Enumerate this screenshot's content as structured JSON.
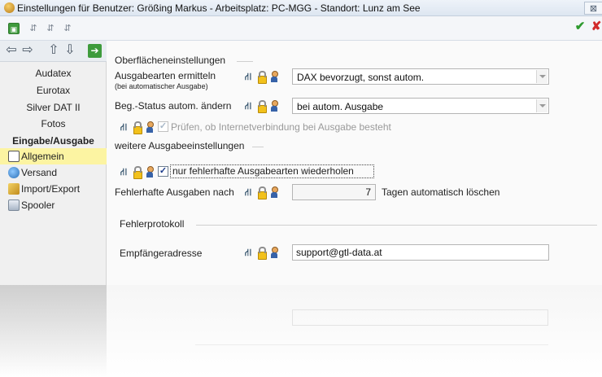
{
  "window": {
    "title": "Einstellungen für Benutzer: Größing Markus - Arbeitsplatz: PC-MGG - Standort: Lunz am See",
    "close_glyph": "⊠"
  },
  "toolbar": {
    "save_glyph": "▣",
    "tool2_glyph": "⇵",
    "tool3_glyph": "⇵",
    "tool4_glyph": "⇵",
    "ok_glyph": "✔",
    "cancel_glyph": "✘"
  },
  "sidebar": {
    "nav": {
      "back": "⇦",
      "forward": "⇨",
      "up": "⇧",
      "down": "⇩",
      "go": "➔"
    },
    "items": [
      {
        "label": "Audatex"
      },
      {
        "label": "Eurotax"
      },
      {
        "label": "Silver DAT II"
      },
      {
        "label": "Fotos"
      },
      {
        "label": "Eingabe/Ausgabe"
      },
      {
        "label": "Allgemein"
      },
      {
        "label": "Versand"
      },
      {
        "label": "Import/Export"
      },
      {
        "label": "Spooler"
      }
    ]
  },
  "main": {
    "section_ui": "Oberflächeneinstellungen",
    "ausgabearten_label": "Ausgabearten ermitteln",
    "ausgabearten_sublabel": "(bei automatischer Ausgabe)",
    "ausgabearten_value": "DAX bevorzugt, sonst autom.",
    "begstatus_label": "Beg.-Status autom. ändern",
    "begstatus_value": "bei autom. Ausgabe",
    "internet_check_label": "Prüfen, ob Internetverbindung bei Ausgabe besteht",
    "internet_checked": true,
    "section_weitere": "weitere Ausgabeeinstellungen",
    "nur_fehlerhafte_label": "nur fehlerhafte Ausgabearten wiederholen",
    "nur_fehlerhafte_checked": true,
    "fehlerhafte_label": "Fehlerhafte Ausgaben nach",
    "fehlerhafte_days": "7",
    "fehlerhafte_suffix": "Tagen automatisch löschen",
    "section_fehler": "Fehlerprotokoll",
    "empfaenger_label": "Empfängeradresse",
    "empfaenger_value": "support@gtl-data.at",
    "check_glyph": "✓"
  },
  "colors": {
    "selected_item": "#fcf4a2",
    "save_green": "#3f9a3d",
    "ok_green": "#2e9a2e",
    "cancel_red": "#d22a2a"
  }
}
